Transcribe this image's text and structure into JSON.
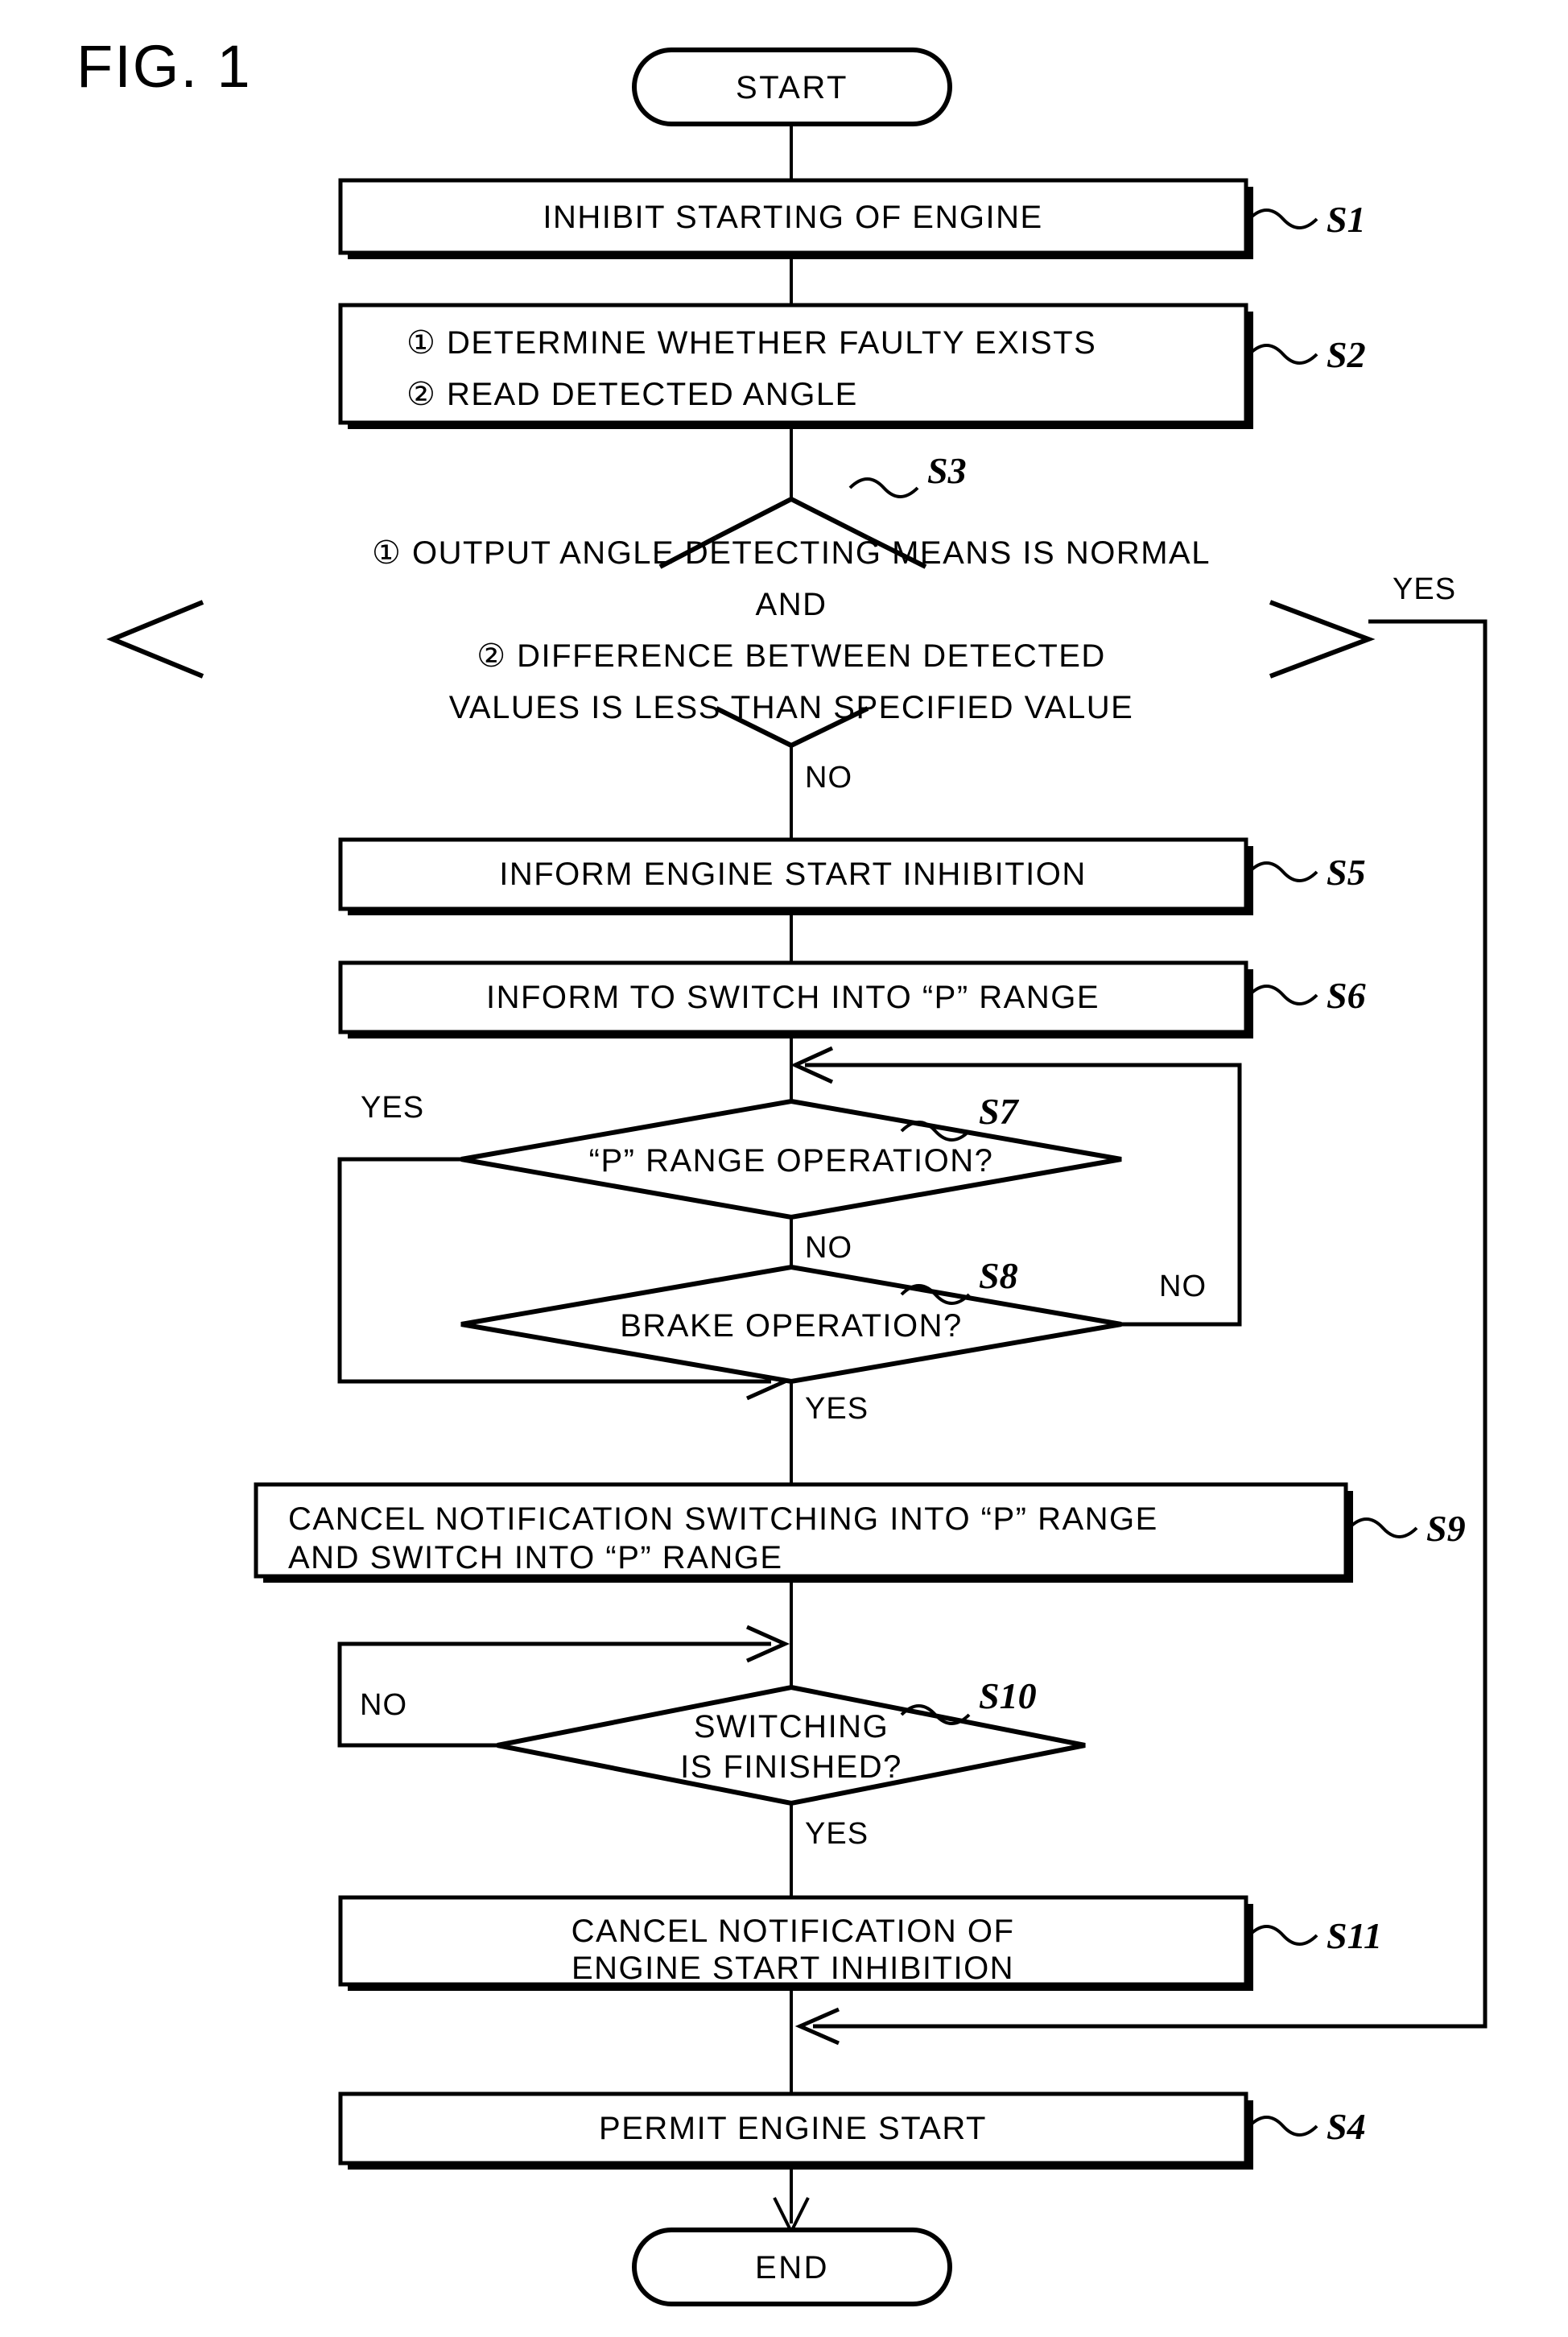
{
  "figure": {
    "label": "FIG. 1",
    "type": "patent-flowchart"
  },
  "terminals": {
    "start": "START",
    "end": "END"
  },
  "steps": [
    {
      "id": "S1",
      "tag": "S1",
      "shape": "process",
      "lines": [
        "INHIBIT STARTING OF ENGINE"
      ]
    },
    {
      "id": "S2",
      "tag": "S2",
      "shape": "process",
      "lines": [
        "① DETERMINE WHETHER FAULTY EXISTS",
        "② READ DETECTED ANGLE"
      ]
    },
    {
      "id": "S3",
      "tag": "S3",
      "shape": "decision",
      "lines": [
        "① OUTPUT ANGLE DETECTING MEANS IS NORMAL",
        "AND",
        "② DIFFERENCE BETWEEN DETECTED",
        "VALUES IS LESS THAN SPECIFIED VALUE"
      ]
    },
    {
      "id": "S5",
      "tag": "S5",
      "shape": "process",
      "lines": [
        "INFORM ENGINE START INHIBITION"
      ]
    },
    {
      "id": "S6",
      "tag": "S6",
      "shape": "process",
      "lines": [
        "INFORM TO SWITCH INTO “P” RANGE"
      ]
    },
    {
      "id": "S7",
      "tag": "S7",
      "shape": "decision",
      "lines": [
        "“P” RANGE OPERATION?"
      ]
    },
    {
      "id": "S8",
      "tag": "S8",
      "shape": "decision",
      "lines": [
        "BRAKE OPERATION?"
      ]
    },
    {
      "id": "S9",
      "tag": "S9",
      "shape": "process",
      "lines": [
        "CANCEL NOTIFICATION SWITCHING INTO “P” RANGE",
        "AND SWITCH INTO “P” RANGE"
      ]
    },
    {
      "id": "S10",
      "tag": "S10",
      "shape": "decision",
      "lines": [
        "SWITCHING",
        "IS FINISHED?"
      ]
    },
    {
      "id": "S11",
      "tag": "S11",
      "shape": "process",
      "lines": [
        "CANCEL NOTIFICATION OF",
        "ENGINE START INHIBITION"
      ]
    },
    {
      "id": "S4",
      "tag": "S4",
      "shape": "process",
      "lines": [
        "PERMIT ENGINE START"
      ]
    }
  ],
  "branch_labels": {
    "s3_yes": "YES",
    "s3_no": "NO",
    "s7_yes": "YES",
    "s7_no": "NO",
    "s8_no": "NO",
    "s8_yes": "YES",
    "s10_no": "NO",
    "s10_yes": "YES"
  },
  "step_tags": {
    "s1": "S1",
    "s2": "S2",
    "s3": "S3",
    "s4": "S4",
    "s5": "S5",
    "s6": "S6",
    "s7": "S7",
    "s8": "S8",
    "s9": "S9",
    "s10": "S10",
    "s11": "S11"
  },
  "text": {
    "s1_l1": "INHIBIT STARTING OF ENGINE",
    "s2_l1": "① DETERMINE WHETHER FAULTY EXISTS",
    "s2_l2": "② READ DETECTED ANGLE",
    "s3_l1": "① OUTPUT ANGLE DETECTING MEANS IS NORMAL",
    "s3_l2": "AND",
    "s3_l3": "② DIFFERENCE BETWEEN DETECTED",
    "s3_l4": "VALUES IS LESS THAN SPECIFIED VALUE",
    "s5_l1": "INFORM ENGINE START INHIBITION",
    "s6_l1": "INFORM TO SWITCH INTO “P” RANGE",
    "s7_l1": "“P” RANGE OPERATION?",
    "s8_l1": "BRAKE OPERATION?",
    "s9_l1": "CANCEL NOTIFICATION SWITCHING INTO “P” RANGE",
    "s9_l2": "AND SWITCH INTO “P” RANGE",
    "s10_l1": "SWITCHING",
    "s10_l2": "IS FINISHED?",
    "s11_l1": "CANCEL NOTIFICATION OF",
    "s11_l2": "ENGINE START INHIBITION",
    "s4_l1": "PERMIT ENGINE START"
  },
  "colors": {
    "ink": "#000000",
    "paper": "#ffffff"
  }
}
